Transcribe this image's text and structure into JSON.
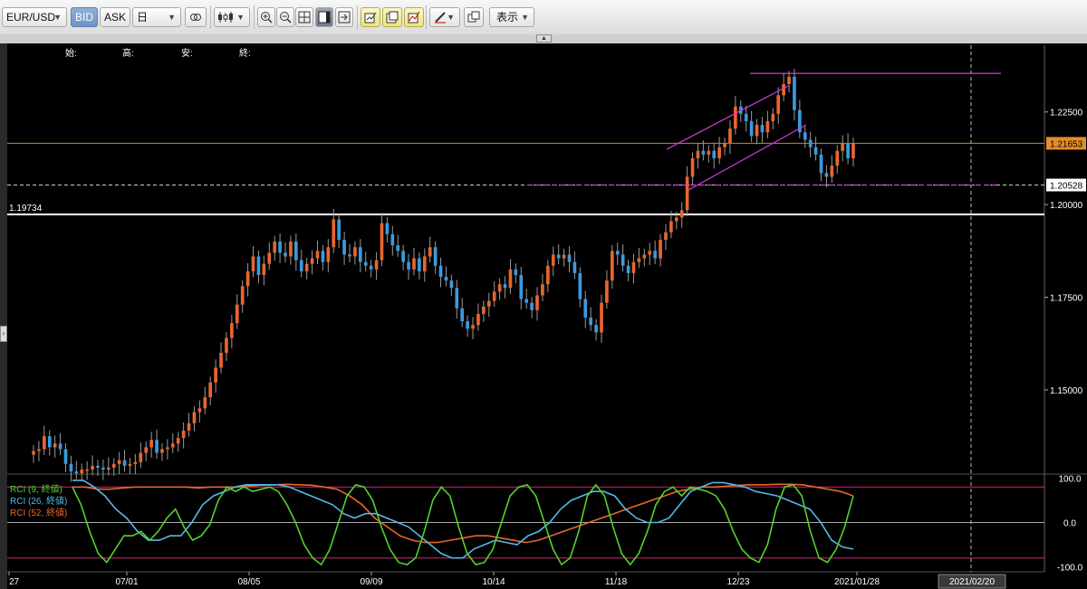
{
  "toolbar": {
    "symbol": "EUR/USD",
    "bid_label": "BID",
    "ask_label": "ASK",
    "timeframe": "日",
    "display_label": "表示"
  },
  "ohlc_header": {
    "open_label": "始:",
    "high_label": "高:",
    "low_label": "安:",
    "close_label": "終:"
  },
  "colors": {
    "up_candle": "#e8662d",
    "down_candle": "#3a9ae0",
    "rci9": "#55d12e",
    "rci26": "#55b8e6",
    "rci52": "#e8662d",
    "channel": "#d23ee0",
    "price_line": "#c98a2e"
  },
  "chart_data": {
    "type": "candlestick",
    "symbol": "EUR/USD",
    "interval": "daily",
    "y_ticks": [
      "1.22500",
      "1.20000",
      "1.17500",
      "1.15000"
    ],
    "y_tick_values": [
      1.225,
      1.2,
      1.175,
      1.15
    ],
    "ylim": [
      1.128,
      1.243
    ],
    "x_tick_labels": [
      "27",
      "07/01",
      "08/05",
      "09/09",
      "10/14",
      "11/18",
      "12/23",
      "2021/01/28"
    ],
    "future_date_label": "2021/02/20",
    "current_price_label": "1.21653",
    "current_price": 1.21653,
    "level_1_label": "1.20528",
    "level_1": 1.20528,
    "level_2_label": "1.19734",
    "level_2": 1.19734,
    "resistance_level": 1.2354,
    "closes": [
      1.1335,
      1.134,
      1.1375,
      1.1345,
      1.1355,
      1.134,
      1.13,
      1.128,
      1.1275,
      1.1285,
      1.1285,
      1.1295,
      1.129,
      1.1285,
      1.129,
      1.13,
      1.131,
      1.1295,
      1.13,
      1.1305,
      1.133,
      1.1345,
      1.1365,
      1.133,
      1.134,
      1.1345,
      1.1355,
      1.137,
      1.139,
      1.141,
      1.144,
      1.145,
      1.148,
      1.152,
      1.156,
      1.16,
      1.164,
      1.168,
      1.173,
      1.178,
      1.182,
      1.186,
      1.181,
      1.184,
      1.187,
      1.19,
      1.187,
      1.186,
      1.19,
      1.185,
      1.182,
      1.184,
      1.1855,
      1.1875,
      1.1845,
      1.1885,
      1.196,
      1.1905,
      1.1865,
      1.186,
      1.1885,
      1.1845,
      1.1835,
      1.1825,
      1.185,
      1.195,
      1.192,
      1.189,
      1.1875,
      1.1845,
      1.1825,
      1.1855,
      1.182,
      1.186,
      1.1885,
      1.1835,
      1.1805,
      1.1795,
      1.1775,
      1.172,
      1.1685,
      1.1665,
      1.1675,
      1.1705,
      1.1725,
      1.174,
      1.1765,
      1.1785,
      1.1775,
      1.1825,
      1.181,
      1.1745,
      1.1735,
      1.1715,
      1.1755,
      1.1785,
      1.1835,
      1.1865,
      1.1855,
      1.1865,
      1.1845,
      1.1815,
      1.1745,
      1.1695,
      1.1675,
      1.1655,
      1.1735,
      1.1795,
      1.1875,
      1.1865,
      1.1835,
      1.1815,
      1.1845,
      1.1855,
      1.1865,
      1.1875,
      1.1855,
      1.1905,
      1.1925,
      1.1955,
      1.1965,
      1.1985,
      1.2075,
      1.2125,
      1.2145,
      1.2135,
      1.2145,
      1.2125,
      1.2155,
      1.2165,
      1.2205,
      1.2265,
      1.2245,
      1.2225,
      1.2185,
      1.2215,
      1.2195,
      1.2225,
      1.2245,
      1.2295,
      1.2325,
      1.2345,
      1.2255,
      1.2195,
      1.2175,
      1.2155,
      1.2135,
      1.2085,
      1.2075,
      1.2105,
      1.2145,
      1.2165,
      1.2125,
      1.2165
    ]
  },
  "rci": {
    "legend": [
      "RCI (9, 終値)",
      "RCI (26, 終値)",
      "RCI (52, 終値)"
    ],
    "y_ticks": [
      "100.0",
      "0.0",
      "-100.0"
    ],
    "y_tick_values": [
      100,
      0,
      -100
    ],
    "ylim": [
      -103,
      103
    ],
    "upper_level": 80,
    "lower_level": -80,
    "rci9_values": [
      80,
      40,
      -20,
      -70,
      -90,
      -60,
      -30,
      -30,
      -20,
      -40,
      -20,
      10,
      30,
      -10,
      -40,
      -30,
      -5,
      50,
      80,
      70,
      80,
      70,
      75,
      80,
      70,
      40,
      0,
      -50,
      -80,
      -95,
      -60,
      0,
      60,
      85,
      80,
      50,
      -10,
      -60,
      -90,
      -95,
      -80,
      -20,
      50,
      80,
      60,
      -10,
      -70,
      -95,
      -90,
      -60,
      0,
      60,
      80,
      85,
      60,
      0,
      -60,
      -95,
      -80,
      -20,
      60,
      85,
      60,
      -10,
      -70,
      -95,
      -70,
      -20,
      40,
      70,
      80,
      60,
      80,
      75,
      70,
      60,
      30,
      -20,
      -60,
      -80,
      -90,
      -50,
      30,
      80,
      85,
      60,
      -20,
      -80,
      -90,
      -60,
      -10,
      60
    ],
    "rci26_values": [
      95,
      95,
      80,
      60,
      30,
      10,
      -20,
      -40,
      -40,
      -30,
      -30,
      0,
      40,
      60,
      70,
      80,
      85,
      85,
      85,
      85,
      80,
      70,
      60,
      50,
      40,
      20,
      10,
      20,
      20,
      10,
      0,
      -10,
      -30,
      -50,
      -70,
      -80,
      -80,
      -60,
      -50,
      -40,
      -45,
      -50,
      -30,
      -20,
      0,
      30,
      50,
      60,
      70,
      70,
      60,
      30,
      10,
      0,
      0,
      10,
      40,
      70,
      80,
      90,
      90,
      85,
      80,
      70,
      65,
      60,
      50,
      40,
      30,
      0,
      -40,
      -55,
      -60
    ],
    "rci52_values": [
      80,
      80,
      75,
      75,
      78,
      80,
      80,
      80,
      80,
      80,
      78,
      80,
      80,
      80,
      82,
      84,
      85,
      86,
      85,
      84,
      80,
      75,
      60,
      40,
      10,
      -10,
      -30,
      -40,
      -45,
      -45,
      -40,
      -35,
      -30,
      -30,
      -35,
      -40,
      -45,
      -40,
      -30,
      -20,
      -10,
      0,
      10,
      20,
      30,
      40,
      50,
      60,
      70,
      75,
      80,
      80,
      82,
      84,
      85,
      85,
      86,
      86,
      85,
      80,
      75,
      70,
      60
    ]
  }
}
